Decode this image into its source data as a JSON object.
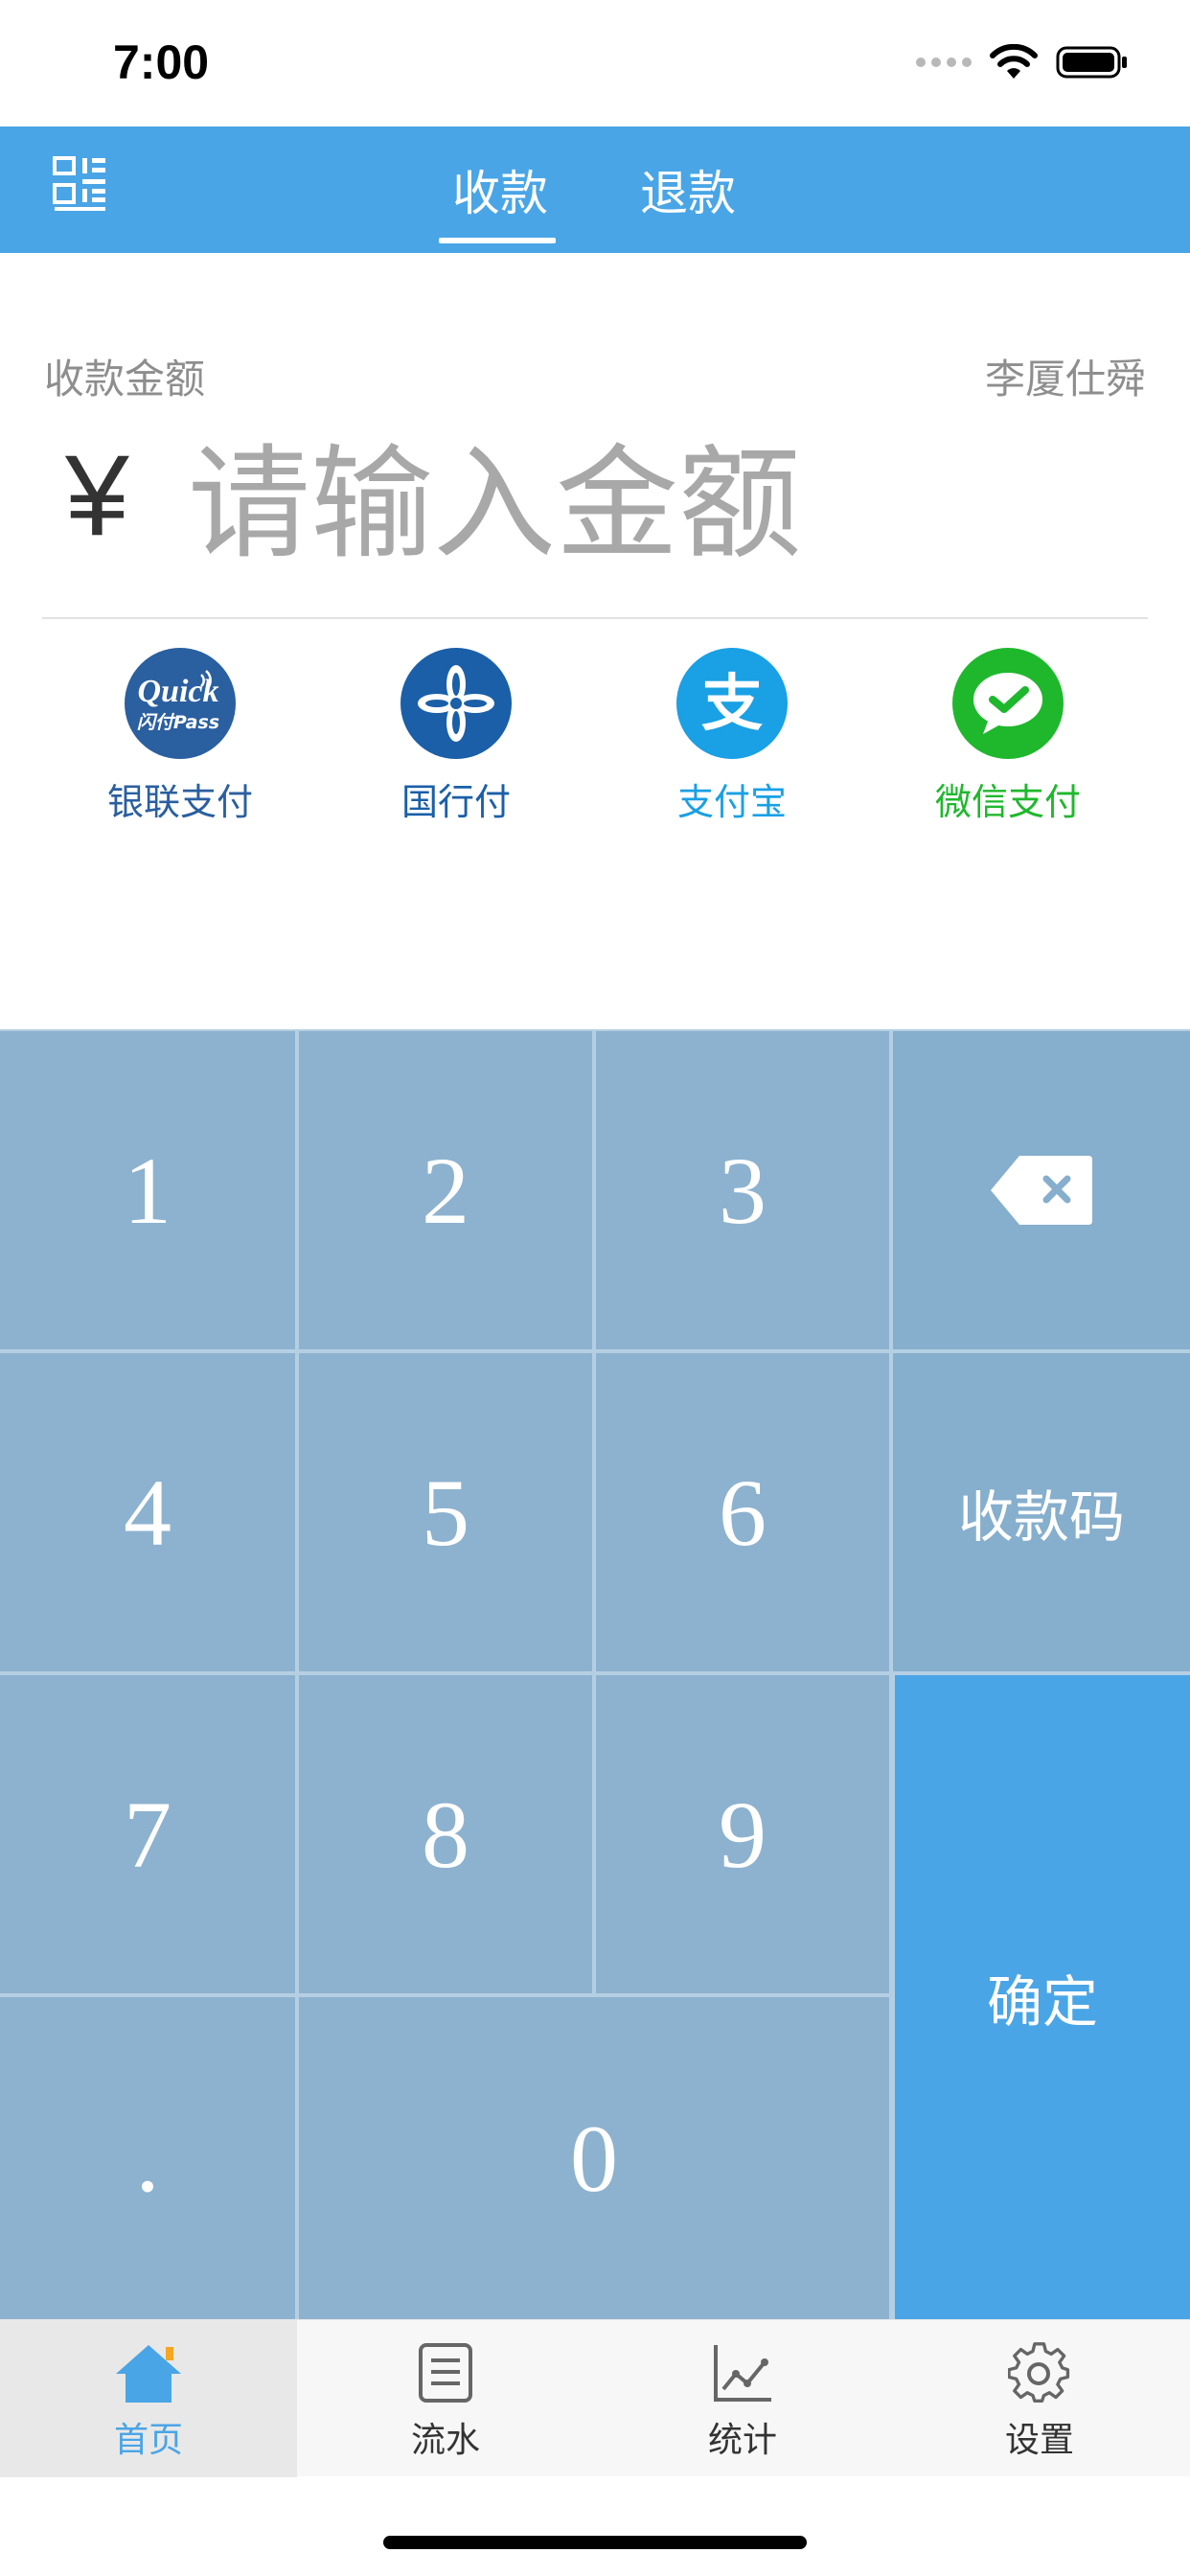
{
  "status_bar": {
    "time": "7:00"
  },
  "header": {
    "qr_icon": "qr-scan-icon",
    "tabs": [
      {
        "label": "收款",
        "active": true
      },
      {
        "label": "退款",
        "active": false
      }
    ],
    "background": "#49a5e6"
  },
  "amount": {
    "label": "收款金额",
    "merchant": "李厦仕舜",
    "currency_symbol": "¥",
    "placeholder": "请输入金额"
  },
  "payment_methods": [
    {
      "label": "银联支付",
      "icon": "quickpass-icon",
      "icon_text": "Quick",
      "icon_subtext": "闪付Pass",
      "color": "#2a5fa0"
    },
    {
      "label": "国行付",
      "icon": "guohangfu-icon",
      "color": "#1a5fa8"
    },
    {
      "label": "支付宝",
      "icon": "alipay-icon",
      "icon_text": "支",
      "color": "#1aa0e4"
    },
    {
      "label": "微信支付",
      "icon": "wechat-pay-icon",
      "color": "#1fb82d"
    }
  ],
  "keypad": {
    "keys": [
      "1",
      "2",
      "3",
      "4",
      "5",
      "6",
      "7",
      "8",
      "9",
      ".",
      "0"
    ],
    "backspace_icon": "backspace-icon",
    "collect_code": "收款码",
    "confirm": "确定",
    "confirm_color": "#49a5e6"
  },
  "tabbar": {
    "items": [
      {
        "label": "首页",
        "icon": "home-icon",
        "active": true
      },
      {
        "label": "流水",
        "icon": "list-icon",
        "active": false
      },
      {
        "label": "统计",
        "icon": "chart-icon",
        "active": false
      },
      {
        "label": "设置",
        "icon": "gear-icon",
        "active": false
      }
    ],
    "active_color": "#49a5e6"
  }
}
